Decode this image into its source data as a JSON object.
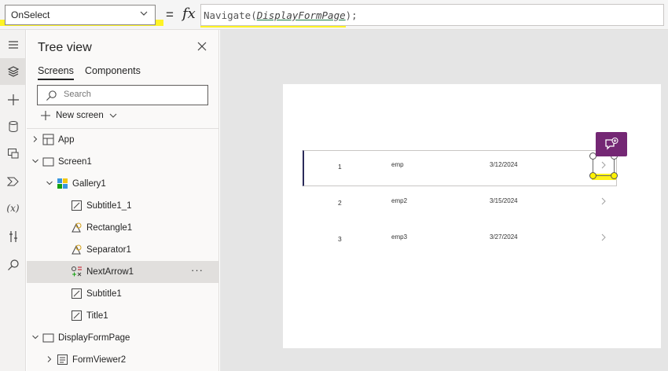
{
  "formula_bar": {
    "property": "OnSelect",
    "equals": "=",
    "fx": "fx",
    "formula_prefix": "Navigate(",
    "formula_ref": "DisplayFormPage",
    "formula_suffix": ");"
  },
  "rail": {
    "items": [
      "hamburger-icon",
      "layers-icon",
      "plus-icon",
      "database-icon",
      "media-icon",
      "power-automate-icon",
      "variables-icon",
      "tools-icon",
      "search-icon"
    ],
    "variables_label": "(x)"
  },
  "tree": {
    "title": "Tree view",
    "tabs": [
      "Screens",
      "Components"
    ],
    "search_placeholder": "Search",
    "new_screen": "New screen",
    "rows": [
      {
        "label": "App",
        "indent": 0,
        "caret": "right",
        "icon": "app-icon"
      },
      {
        "label": "Screen1",
        "indent": 0,
        "caret": "down",
        "icon": "screen-icon"
      },
      {
        "label": "Gallery1",
        "indent": 1,
        "caret": "down",
        "icon": "gallery-icon"
      },
      {
        "label": "Subtitle1_1",
        "indent": 2,
        "caret": "",
        "icon": "label-icon"
      },
      {
        "label": "Rectangle1",
        "indent": 2,
        "caret": "",
        "icon": "shape-icon"
      },
      {
        "label": "Separator1",
        "indent": 2,
        "caret": "",
        "icon": "shape-icon"
      },
      {
        "label": "NextArrow1",
        "indent": 2,
        "caret": "",
        "icon": "icon-control-icon",
        "selected": true,
        "more": "···"
      },
      {
        "label": "Subtitle1",
        "indent": 2,
        "caret": "",
        "icon": "label-icon"
      },
      {
        "label": "Title1",
        "indent": 2,
        "caret": "",
        "icon": "label-icon"
      },
      {
        "label": "DisplayFormPage",
        "indent": 0,
        "caret": "down",
        "icon": "screen-icon"
      },
      {
        "label": "FormViewer2",
        "indent": 1,
        "caret": "right",
        "icon": "form-icon"
      }
    ]
  },
  "gallery": {
    "rows": [
      {
        "num": "1",
        "name": "emp",
        "date": "3/12/2024"
      },
      {
        "num": "2",
        "name": "emp2",
        "date": "3/15/2024"
      },
      {
        "num": "3",
        "name": "emp3",
        "date": "3/27/2024"
      }
    ]
  },
  "colors": {
    "highlight": "#fff200",
    "accent_purple": "#742774",
    "formula_ref_underline": "#1a7a44"
  }
}
